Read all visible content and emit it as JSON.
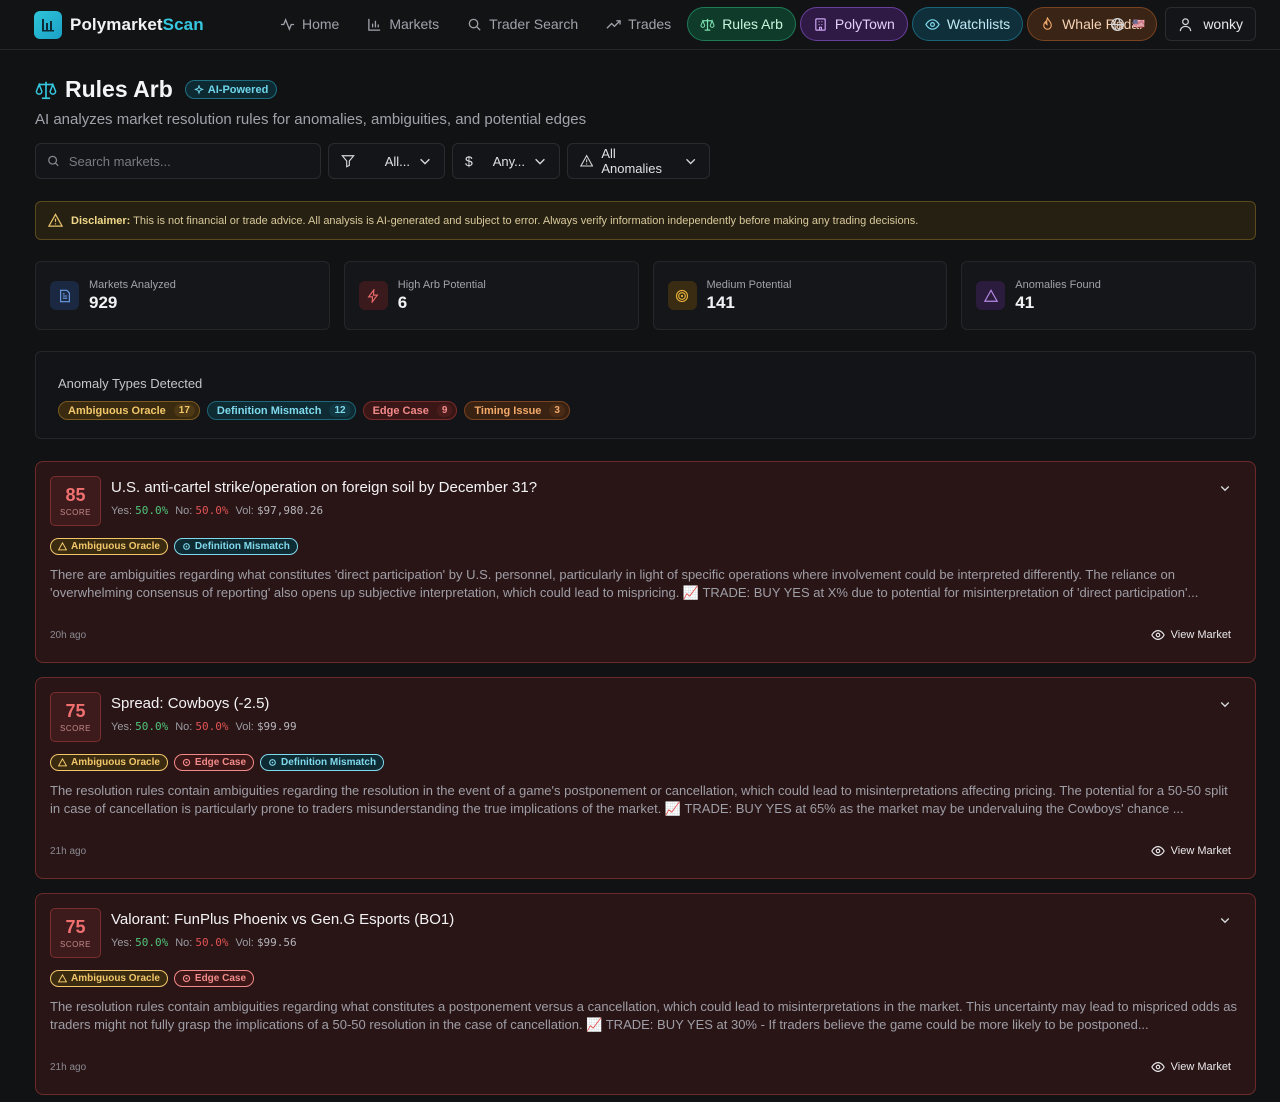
{
  "brand": {
    "name_main": "Polymarket",
    "name_accent": "Scan"
  },
  "nav": {
    "links": [
      {
        "label": "Home",
        "icon": "activity-icon"
      },
      {
        "label": "Markets",
        "icon": "bar-chart-icon"
      },
      {
        "label": "Trader Search",
        "icon": "search-icon"
      },
      {
        "label": "Trades",
        "icon": "trending-up-icon"
      }
    ],
    "pills": [
      {
        "label": "Rules Arb",
        "icon": "scale-icon",
        "color": "#1f7a56"
      },
      {
        "label": "PolyTown",
        "icon": "building-icon",
        "color": "#6a3f9a"
      },
      {
        "label": "Watchlists",
        "icon": "eye-icon",
        "color": "#1b6478"
      },
      {
        "label": "Whale Radar",
        "icon": "flame-icon",
        "color": "#7a4420"
      }
    ],
    "flag": "🇺🇸",
    "user": "wonky"
  },
  "header": {
    "title": "Rules Arb",
    "badge": "AI-Powered",
    "subtitle": "AI analyzes market resolution rules for anomalies, ambiguities, and potential edges"
  },
  "filters": {
    "search_placeholder": "Search markets...",
    "category": "All...",
    "volume": "Any...",
    "anomaly": "All Anomalies"
  },
  "disclaimer": {
    "label": "Disclaimer:",
    "text": "This is not financial or trade advice. All analysis is AI-generated and subject to error. Always verify information independently before making any trading decisions."
  },
  "stats": [
    {
      "label": "Markets Analyzed",
      "value": "929",
      "icon": "document-icon",
      "color": "#4a7fd6"
    },
    {
      "label": "High Arb Potential",
      "value": "6",
      "icon": "zap-icon",
      "color": "#e05252"
    },
    {
      "label": "Medium Potential",
      "value": "141",
      "icon": "target-icon",
      "color": "#e0a530"
    },
    {
      "label": "Anomalies Found",
      "value": "41",
      "icon": "alert-triangle-icon",
      "color": "#a06ad6"
    }
  ],
  "anomaly_types": {
    "title": "Anomaly Types Detected",
    "items": [
      {
        "label": "Ambiguous Oracle",
        "count": "17"
      },
      {
        "label": "Definition Mismatch",
        "count": "12"
      },
      {
        "label": "Edge Case",
        "count": "9"
      },
      {
        "label": "Timing Issue",
        "count": "3"
      }
    ]
  },
  "markets": [
    {
      "score": "85",
      "score_label": "SCORE",
      "title": "U.S. anti-cartel strike/operation on foreign soil by December 31?",
      "yes_label": "Yes:",
      "yes": "50.0%",
      "no_label": "No:",
      "no": "50.0%",
      "vol_label": "Vol:",
      "vol": "$97,980.26",
      "tags": [
        "Ambiguous Oracle",
        "Definition Mismatch"
      ],
      "description": "There are ambiguities regarding what constitutes 'direct participation' by U.S. personnel, particularly in light of specific operations where involvement could be interpreted differently. The reliance on 'overwhelming consensus of reporting' also opens up subjective interpretation, which could lead to mispricing. 📈 TRADE: BUY YES at X% due to potential for misinterpretation of 'direct participation'...",
      "ago": "20h ago",
      "action": "View Market"
    },
    {
      "score": "75",
      "score_label": "SCORE",
      "title": "Spread: Cowboys (-2.5)",
      "yes_label": "Yes:",
      "yes": "50.0%",
      "no_label": "No:",
      "no": "50.0%",
      "vol_label": "Vol:",
      "vol": "$99.99",
      "tags": [
        "Ambiguous Oracle",
        "Edge Case",
        "Definition Mismatch"
      ],
      "description": "The resolution rules contain ambiguities regarding the resolution in the event of a game's postponement or cancellation, which could lead to misinterpretations affecting pricing. The potential for a 50-50 split in case of cancellation is particularly prone to traders misunderstanding the true implications of the market. 📈 TRADE: BUY YES at 65% as the market may be undervaluing the Cowboys' chance ...",
      "ago": "21h ago",
      "action": "View Market"
    },
    {
      "score": "75",
      "score_label": "SCORE",
      "title": "Valorant: FunPlus Phoenix vs Gen.G Esports (BO1)",
      "yes_label": "Yes:",
      "yes": "50.0%",
      "no_label": "No:",
      "no": "50.0%",
      "vol_label": "Vol:",
      "vol": "$99.56",
      "tags": [
        "Ambiguous Oracle",
        "Edge Case"
      ],
      "description": "The resolution rules contain ambiguities regarding what constitutes a postponement versus a cancellation, which could lead to misinterpretations in the market. This uncertainty may lead to mispriced odds as traders might not fully grasp the implications of a 50-50 resolution in the case of cancellation. 📈 TRADE: BUY YES at 30% - If traders believe the game could be more likely to be postponed...",
      "ago": "21h ago",
      "action": "View Market"
    }
  ]
}
